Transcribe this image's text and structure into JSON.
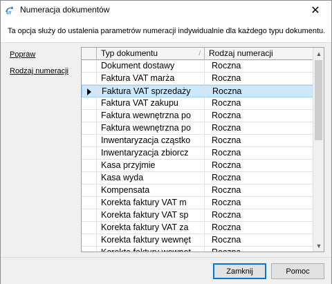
{
  "window": {
    "title": "Numeracja dokumentów",
    "close_glyph": "✕",
    "icon": "app-logo-icon"
  },
  "info": {
    "text": "Ta opcja służy do ustalenia parametrów numeracji indywidualnie dla każdego typu dokumentu."
  },
  "sidebar": {
    "items": [
      {
        "label": "Popraw"
      },
      {
        "label": "Rodzaj numeracji"
      }
    ]
  },
  "grid": {
    "columns": [
      {
        "label": "Typ dokumentu",
        "sort_glyph": "/"
      },
      {
        "label": "Rodzaj numeracji"
      }
    ],
    "selected_index": 2,
    "rows": [
      {
        "type": "Dokument dostawy",
        "numbering": "Roczna"
      },
      {
        "type": "Faktura VAT marża",
        "numbering": "Roczna"
      },
      {
        "type": "Faktura VAT sprzedaży",
        "numbering": "Roczna"
      },
      {
        "type": "Faktura VAT zakupu",
        "numbering": "Roczna"
      },
      {
        "type": "Faktura wewnętrzna po",
        "numbering": "Roczna"
      },
      {
        "type": "Faktura wewnętrzna po",
        "numbering": "Roczna"
      },
      {
        "type": "Inwentaryzacja cząstko",
        "numbering": "Roczna"
      },
      {
        "type": "Inwentaryzacja zbiorcz",
        "numbering": "Roczna"
      },
      {
        "type": "Kasa przyjmie",
        "numbering": "Roczna"
      },
      {
        "type": "Kasa wyda",
        "numbering": "Roczna"
      },
      {
        "type": "Kompensata",
        "numbering": "Roczna"
      },
      {
        "type": "Korekta faktury VAT m",
        "numbering": "Roczna"
      },
      {
        "type": "Korekta faktury VAT sp",
        "numbering": "Roczna"
      },
      {
        "type": "Korekta faktury VAT za",
        "numbering": "Roczna"
      },
      {
        "type": "Korekta faktury wewnęt",
        "numbering": "Roczna"
      },
      {
        "type": "Korekta faktury wewnęt",
        "numbering": "Roczna"
      }
    ]
  },
  "buttons": {
    "close_label": "Zamknij",
    "help_label": "Pomoc"
  },
  "colors": {
    "selection": "#cce8ff",
    "selection_border": "#99d1ff",
    "default_button_border": "#0078d7"
  }
}
